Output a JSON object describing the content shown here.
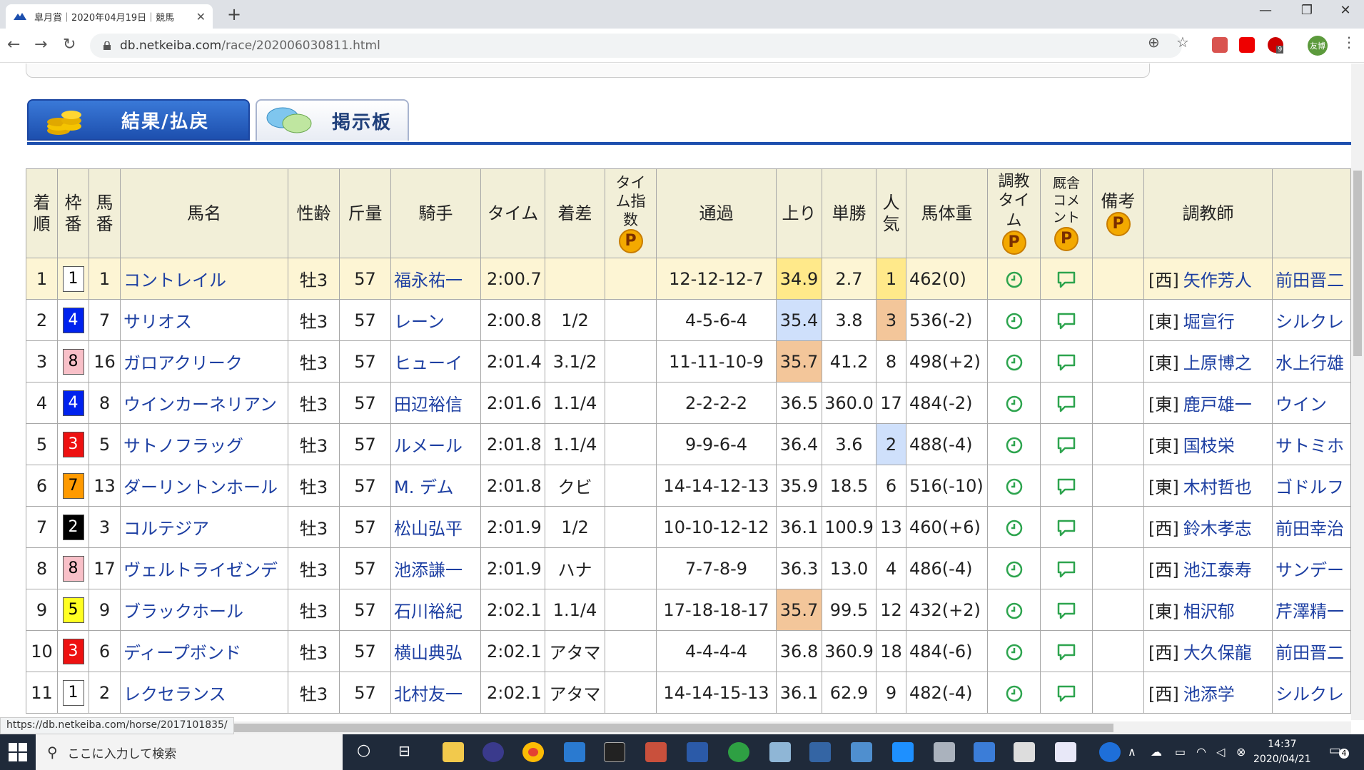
{
  "browser": {
    "tab_title": "皐月賞｜2020年04月19日｜競馬",
    "url_host": "db.netkeiba.com",
    "url_path": "/race/202006030811.html",
    "profile_label": "友博",
    "extension_badge": "9",
    "status_url": "https://db.netkeiba.com/horse/2017101835/"
  },
  "page_tabs": {
    "results_label": "結果/払戻",
    "board_label": "掲示板"
  },
  "table": {
    "headers": {
      "rank": "着順",
      "frame": "枠番",
      "num": "馬番",
      "name": "馬名",
      "sexage": "性齢",
      "weight": "斤量",
      "jockey": "騎手",
      "time": "タイム",
      "margin": "着差",
      "time_index": "タイム指数",
      "passing": "通過",
      "last3f": "上り",
      "odds": "単勝",
      "popularity": "人気",
      "body_weight": "馬体重",
      "training_time": "調教タイム",
      "stable_comment": "厩舎コメント",
      "remarks": "備考",
      "trainer": "調教師",
      "p_badge": "P"
    },
    "rows": [
      {
        "rank": "1",
        "frame": "1",
        "num": "1",
        "name": "コントレイル",
        "sexage": "牡3",
        "weight": "57",
        "jockey": "福永祐一",
        "time": "2:00.7",
        "margin": "",
        "passing": "12-12-12-7",
        "last3f": "34.9",
        "odds": "2.7",
        "pop": "1",
        "bw": "462(0)",
        "region": "[西]",
        "trainer": "矢作芳人",
        "owner": "前田晋二"
      },
      {
        "rank": "2",
        "frame": "4",
        "num": "7",
        "name": "サリオス",
        "sexage": "牡3",
        "weight": "57",
        "jockey": "レーン",
        "time": "2:00.8",
        "margin": "1/2",
        "passing": "4-5-6-4",
        "last3f": "35.4",
        "odds": "3.8",
        "pop": "3",
        "bw": "536(-2)",
        "region": "[東]",
        "trainer": "堀宣行",
        "owner": "シルクレ"
      },
      {
        "rank": "3",
        "frame": "8",
        "num": "16",
        "name": "ガロアクリーク",
        "sexage": "牡3",
        "weight": "57",
        "jockey": "ヒューイ",
        "time": "2:01.4",
        "margin": "3.1/2",
        "passing": "11-11-10-9",
        "last3f": "35.7",
        "odds": "41.2",
        "pop": "8",
        "bw": "498(+2)",
        "region": "[東]",
        "trainer": "上原博之",
        "owner": "水上行雄"
      },
      {
        "rank": "4",
        "frame": "4",
        "num": "8",
        "name": "ウインカーネリアン",
        "sexage": "牡3",
        "weight": "57",
        "jockey": "田辺裕信",
        "time": "2:01.6",
        "margin": "1.1/4",
        "passing": "2-2-2-2",
        "last3f": "36.5",
        "odds": "360.0",
        "pop": "17",
        "bw": "484(-2)",
        "region": "[東]",
        "trainer": "鹿戸雄一",
        "owner": "ウイン"
      },
      {
        "rank": "5",
        "frame": "3",
        "num": "5",
        "name": "サトノフラッグ",
        "sexage": "牡3",
        "weight": "57",
        "jockey": "ルメール",
        "time": "2:01.8",
        "margin": "1.1/4",
        "passing": "9-9-6-4",
        "last3f": "36.4",
        "odds": "3.6",
        "pop": "2",
        "bw": "488(-4)",
        "region": "[東]",
        "trainer": "国枝栄",
        "owner": "サトミホ"
      },
      {
        "rank": "6",
        "frame": "7",
        "num": "13",
        "name": "ダーリントンホール",
        "sexage": "牡3",
        "weight": "57",
        "jockey": "M. デム",
        "time": "2:01.8",
        "margin": "クビ",
        "passing": "14-14-12-13",
        "last3f": "35.9",
        "odds": "18.5",
        "pop": "6",
        "bw": "516(-10)",
        "region": "[東]",
        "trainer": "木村哲也",
        "owner": "ゴドルフ"
      },
      {
        "rank": "7",
        "frame": "2",
        "num": "3",
        "name": "コルテジア",
        "sexage": "牡3",
        "weight": "57",
        "jockey": "松山弘平",
        "time": "2:01.9",
        "margin": "1/2",
        "passing": "10-10-12-12",
        "last3f": "36.1",
        "odds": "100.9",
        "pop": "13",
        "bw": "460(+6)",
        "region": "[西]",
        "trainer": "鈴木孝志",
        "owner": "前田幸治"
      },
      {
        "rank": "8",
        "frame": "8",
        "num": "17",
        "name": "ヴェルトライゼンデ",
        "sexage": "牡3",
        "weight": "57",
        "jockey": "池添謙一",
        "time": "2:01.9",
        "margin": "ハナ",
        "passing": "7-7-8-9",
        "last3f": "36.3",
        "odds": "13.0",
        "pop": "4",
        "bw": "486(-4)",
        "region": "[西]",
        "trainer": "池江泰寿",
        "owner": "サンデー"
      },
      {
        "rank": "9",
        "frame": "5",
        "num": "9",
        "name": "ブラックホール",
        "sexage": "牡3",
        "weight": "57",
        "jockey": "石川裕紀",
        "time": "2:02.1",
        "margin": "1.1/4",
        "passing": "17-18-18-17",
        "last3f": "35.7",
        "odds": "99.5",
        "pop": "12",
        "bw": "432(+2)",
        "region": "[東]",
        "trainer": "相沢郁",
        "owner": "芹澤精一"
      },
      {
        "rank": "10",
        "frame": "3",
        "num": "6",
        "name": "ディープボンド",
        "sexage": "牡3",
        "weight": "57",
        "jockey": "横山典弘",
        "time": "2:02.1",
        "margin": "アタマ",
        "passing": "4-4-4-4",
        "last3f": "36.8",
        "odds": "360.9",
        "pop": "18",
        "bw": "484(-6)",
        "region": "[西]",
        "trainer": "大久保龍",
        "owner": "前田晋二"
      },
      {
        "rank": "11",
        "frame": "1",
        "num": "2",
        "name": "レクセランス",
        "sexage": "牡3",
        "weight": "57",
        "jockey": "北村友一",
        "time": "2:02.1",
        "margin": "アタマ",
        "passing": "14-14-15-13",
        "last3f": "36.1",
        "odds": "62.9",
        "pop": "9",
        "bw": "482(-4)",
        "region": "[西]",
        "trainer": "池添学",
        "owner": "シルクレ"
      }
    ]
  },
  "frame_colors": {
    "1": {
      "bg": "#ffffff",
      "fg": "#000000"
    },
    "2": {
      "bg": "#000000",
      "fg": "#ffffff"
    },
    "3": {
      "bg": "#ee1111",
      "fg": "#ffffff"
    },
    "4": {
      "bg": "#0022ee",
      "fg": "#ffffff"
    },
    "5": {
      "bg": "#ffff22",
      "fg": "#000000"
    },
    "6": {
      "bg": "#22aa33",
      "fg": "#ffffff"
    },
    "7": {
      "bg": "#ff9a00",
      "fg": "#000000"
    },
    "8": {
      "bg": "#f8c0c8",
      "fg": "#000000"
    }
  },
  "highlights": {
    "last3f": {
      "0": "yellow",
      "1": "blue",
      "2": "orange",
      "8": "orange"
    },
    "pop": {
      "0": "yellow",
      "1": "orange",
      "4": "blue"
    }
  },
  "taskbar": {
    "search_placeholder": "ここに入力して検索",
    "time": "14:37",
    "date": "2020/04/21",
    "notif_count": "4"
  }
}
